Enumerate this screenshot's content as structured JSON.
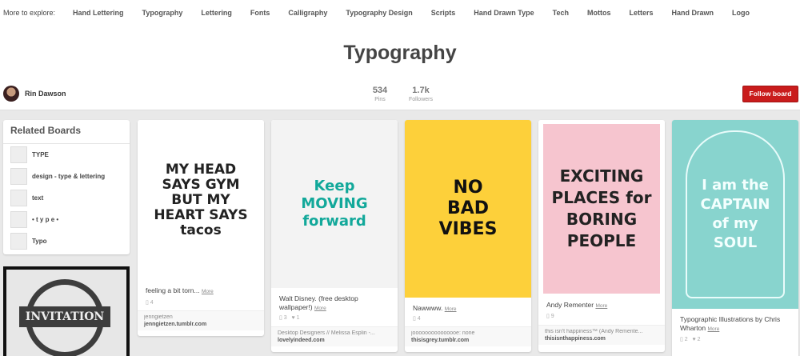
{
  "explore": {
    "lead": "More to explore:",
    "tags": [
      "Hand Lettering",
      "Typography",
      "Lettering",
      "Fonts",
      "Calligraphy",
      "Typography Design",
      "Scripts",
      "Hand Drawn Type",
      "Tech",
      "Mottos",
      "Letters",
      "Hand Drawn",
      "Logo"
    ]
  },
  "board": {
    "title": "Typography",
    "owner": "Rin Dawson",
    "pins_count": "534",
    "pins_label": "Pins",
    "followers_count": "1.7k",
    "followers_label": "Followers",
    "follow_label": "Follow board"
  },
  "related": {
    "heading": "Related Boards",
    "items": [
      {
        "label": "TYPE"
      },
      {
        "label": "design - type & lettering"
      },
      {
        "label": "text"
      },
      {
        "label": "• t y p e •"
      },
      {
        "label": "Typo"
      }
    ]
  },
  "badge_text": "INVITATION",
  "pins": [
    {
      "art": "MY HEAD SAYS GYM BUT MY HEART SAYS tacos",
      "desc": "feeling a bit torn...",
      "more": "More",
      "likes": "4",
      "src_a": "jenngietzen",
      "src_b": "jenngietzen.tumblr.com"
    },
    {
      "art": "Keep MOVING forward",
      "desc": "Walt Disney. (free desktop wallpaper!)",
      "more": "More",
      "likes": "3",
      "hearts": "1",
      "src_a": "Desktop Designers // Melissa Esplin -...",
      "src_b": "lovelyindeed.com"
    },
    {
      "art": "NO BAD VIBES",
      "desc": "Nawwww.",
      "more": "More",
      "likes": "4",
      "src_a": "jooooooooooooooe: none",
      "src_b": "thisisgrey.tumblr.com"
    },
    {
      "art": "EXCITING PLACES for BORING PEOPLE",
      "desc": "Andy Rementer",
      "more": "More",
      "likes": "9",
      "src_a": "this isn't happiness™ (Andy Remente...",
      "src_b": "thisisnthappiness.com"
    },
    {
      "art": "I am the CAPTAIN of my SOUL",
      "desc": "Typographic Illustrations by Chris Wharton",
      "more": "More",
      "likes": "2",
      "hearts": "2",
      "src_a": "",
      "src_b": ""
    }
  ]
}
